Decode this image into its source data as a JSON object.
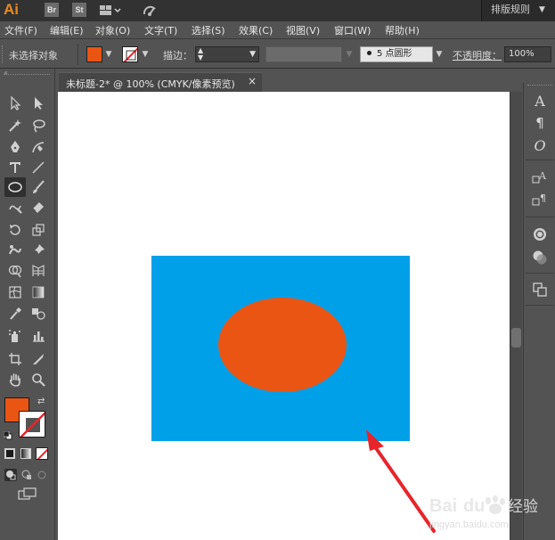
{
  "appbar": {
    "logo": "Ai",
    "bridge_label": "Br",
    "stock_label": "St",
    "workspace": "排版规则"
  },
  "menu": {
    "items": [
      "文件(F)",
      "编辑(E)",
      "对象(O)",
      "文字(T)",
      "选择(S)",
      "效果(C)",
      "视图(V)",
      "窗口(W)",
      "帮助(H)"
    ]
  },
  "control": {
    "selection_status": "未选择对象",
    "fill_color": "#ea5514",
    "stroke_label": "描边：",
    "brush_label": "5 点圆形",
    "opacity_label": "不透明度：",
    "opacity_value": "100%"
  },
  "document": {
    "tab_title": "未标题-2* @ 100% (CMYK/像素预览)",
    "close_glyph": "×"
  },
  "artwork": {
    "background_color": "#ffffff",
    "rect_color": "#00a0e9",
    "ellipse_color": "#ea5514",
    "arrow_color": "#e8242b"
  },
  "colors": {
    "fill_swatch": "#ea5514",
    "stroke_swatch": "#ffffff"
  },
  "watermark": {
    "brand": "Baidu经验",
    "url": "jingyan.baidu.com"
  }
}
